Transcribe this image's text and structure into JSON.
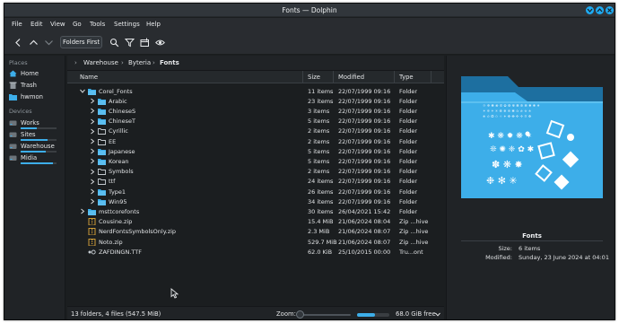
{
  "window": {
    "title": "Fonts — Dolphin"
  },
  "menu": [
    "File",
    "Edit",
    "View",
    "Go",
    "Tools",
    "Settings",
    "Help"
  ],
  "toolbar": {
    "icons": [
      "back-icon",
      "up-icon",
      "search-icon",
      "filter-icon",
      "new-folder-icon",
      "preview-icon"
    ],
    "folders_first_label": "Folders First"
  },
  "places": {
    "places_heading": "Places",
    "items": [
      {
        "label": "Home",
        "icon": "home-icon"
      },
      {
        "label": "Trash",
        "icon": "trash-icon"
      },
      {
        "label": "hwmon",
        "icon": "folder-icon"
      }
    ],
    "devices_heading": "Devices",
    "devices": [
      {
        "label": "Works",
        "used": 0.45
      },
      {
        "label": "Sites",
        "used": 0.75
      },
      {
        "label": "Warehouse",
        "used": 0.7
      },
      {
        "label": "Midia",
        "used": 0.9
      }
    ]
  },
  "breadcrumb": [
    "Warehouse",
    "Byteria",
    "Fonts"
  ],
  "columns": {
    "name": "Name",
    "size": "Size",
    "modified": "Modified",
    "type": "Type"
  },
  "rows": [
    {
      "name": "Corel_Fonts",
      "size": "11 items",
      "modified": "22/07/1999 09:16",
      "type": "Folder",
      "level": 1,
      "expanded": true,
      "kind": "folder"
    },
    {
      "name": "Arabic",
      "size": "23 items",
      "modified": "22/07/1999 09:16",
      "type": "Folder",
      "level": 2,
      "expanded": false,
      "kind": "folder"
    },
    {
      "name": "ChineseS",
      "size": "3 items",
      "modified": "22/07/1999 09:16",
      "type": "Folder",
      "level": 2,
      "expanded": false,
      "kind": "folder"
    },
    {
      "name": "ChineseT",
      "size": "5 items",
      "modified": "22/07/1999 09:16",
      "type": "Folder",
      "level": 2,
      "expanded": false,
      "kind": "folder"
    },
    {
      "name": "Cyrillic",
      "size": "2 items",
      "modified": "22/07/1999 09:16",
      "type": "Folder",
      "level": 2,
      "expanded": false,
      "kind": "folder-empty"
    },
    {
      "name": "EE",
      "size": "2 items",
      "modified": "22/07/1999 09:16",
      "type": "Folder",
      "level": 2,
      "expanded": false,
      "kind": "folder-empty"
    },
    {
      "name": "Japanese",
      "size": "5 items",
      "modified": "22/07/1999 09:16",
      "type": "Folder",
      "level": 2,
      "expanded": false,
      "kind": "folder"
    },
    {
      "name": "Korean",
      "size": "5 items",
      "modified": "22/07/1999 09:16",
      "type": "Folder",
      "level": 2,
      "expanded": false,
      "kind": "folder"
    },
    {
      "name": "Symbols",
      "size": "2 items",
      "modified": "22/07/1999 09:16",
      "type": "Folder",
      "level": 2,
      "expanded": false,
      "kind": "folder-empty"
    },
    {
      "name": "ttf",
      "size": "24 items",
      "modified": "22/07/1999 09:16",
      "type": "Folder",
      "level": 2,
      "expanded": false,
      "kind": "folder-empty"
    },
    {
      "name": "Type1",
      "size": "26 items",
      "modified": "22/07/1999 09:16",
      "type": "Folder",
      "level": 2,
      "expanded": false,
      "kind": "folder"
    },
    {
      "name": "Win95",
      "size": "34 items",
      "modified": "22/07/1999 09:16",
      "type": "Folder",
      "level": 2,
      "expanded": false,
      "kind": "folder"
    },
    {
      "name": "msttcorefonts",
      "size": "30 items",
      "modified": "26/04/2021 15:42",
      "type": "Folder",
      "level": 1,
      "expanded": false,
      "kind": "folder"
    },
    {
      "name": "Cousine.zip",
      "size": "15.4 MiB",
      "modified": "21/06/2024 08:04",
      "type": "Zip ...hive",
      "level": 1,
      "expanded": null,
      "kind": "zip"
    },
    {
      "name": "NerdFontsSymbolsOnly.zip",
      "size": "2.3 MiB",
      "modified": "21/06/2024 08:07",
      "type": "Zip ...hive",
      "level": 1,
      "expanded": null,
      "kind": "zip"
    },
    {
      "name": "Noto.zip",
      "size": "529.7 MiB",
      "modified": "21/06/2024 08:07",
      "type": "Zip ...hive",
      "level": 1,
      "expanded": null,
      "kind": "zip"
    },
    {
      "name": "ZAFDINGN.TTF",
      "size": "62.0 KiB",
      "modified": "25/10/2015 00:00",
      "type": "Tru...ont",
      "level": 1,
      "expanded": null,
      "kind": "font"
    }
  ],
  "status": {
    "summary": "13 folders, 4 files (547.5 MiB)",
    "zoom_label": "Zoom:",
    "free_space": "68.0 GiB free",
    "space_used": 0.55
  },
  "info_panel": {
    "title": "Fonts",
    "size_label": "Size:",
    "size_value": "6 items",
    "modified_label": "Modified:",
    "modified_value": "Sunday, 23 June 2024 at 04:01"
  },
  "colors": {
    "accent": "#3daee9",
    "background": "#1b1e20",
    "folder": "#3daee9"
  }
}
